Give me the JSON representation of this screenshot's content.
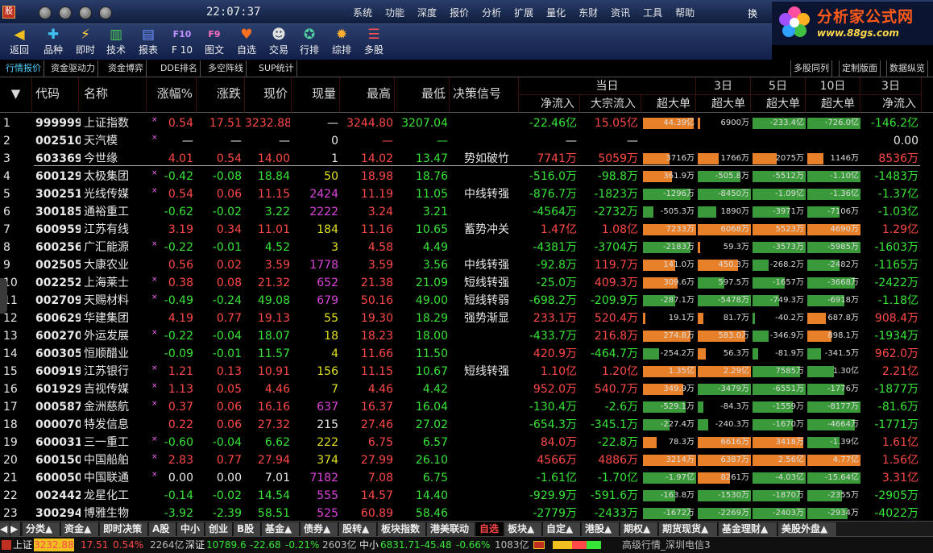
{
  "clock": "22:07:37",
  "menu": [
    "系统",
    "功能",
    "深度",
    "报价",
    "分析",
    "扩展",
    "量化",
    "东财",
    "资讯",
    "工具",
    "帮助"
  ],
  "menu_extra": "换",
  "logo": {
    "text": "分析家公式网",
    "url": "www.88gs.com"
  },
  "toolbar": [
    {
      "label": "返回",
      "icon": "arrow-left-icon",
      "glyph": "◀",
      "color": "#f0c020"
    },
    {
      "label": "品种",
      "icon": "category-icon",
      "glyph": "✚",
      "color": "#40c0f0"
    },
    {
      "label": "即时",
      "icon": "lightning-icon",
      "glyph": "⚡",
      "color": "#ffd040"
    },
    {
      "label": "技术",
      "icon": "candlestick-icon",
      "glyph": "▥",
      "color": "#50d050"
    },
    {
      "label": "报表",
      "icon": "table-icon",
      "glyph": "▤",
      "color": "#7090ff"
    },
    {
      "label": "F 10",
      "icon": "f10-icon",
      "glyph": "F10",
      "color": "#c090ff"
    },
    {
      "label": "图文",
      "icon": "f9-icon",
      "glyph": "F9",
      "color": "#ff70c0"
    },
    {
      "label": "自选",
      "icon": "heart-icon",
      "glyph": "♥",
      "color": "#ff7020"
    },
    {
      "label": "交易",
      "icon": "user-icon",
      "glyph": "☻",
      "color": "#e0e0e0"
    },
    {
      "label": "行排",
      "icon": "star-icon",
      "glyph": "✪",
      "color": "#50d0a0"
    },
    {
      "label": "综排",
      "icon": "starburst-icon",
      "glyph": "✹",
      "color": "#ffb030"
    },
    {
      "label": "多股",
      "icon": "multi-icon",
      "glyph": "☰",
      "color": "#ff5050"
    }
  ],
  "tabs_left": [
    "行情报价",
    "资金驱动力",
    "资金博弈",
    "DDE排名",
    "多空阵线",
    "SUP统计"
  ],
  "tabs_right": [
    "多股同列",
    "定制版面",
    "数据纵览"
  ],
  "columns": [
    "代码",
    "名称",
    "涨幅%",
    "涨跌",
    "现价",
    "现量",
    "最高",
    "最低",
    "决策信号"
  ],
  "groups": [
    "当日",
    "3日",
    "5日",
    "10日",
    "3日"
  ],
  "subcolumns": [
    "净流入",
    "大宗流入",
    "超大单",
    "超大单",
    "超大单",
    "超大单",
    "净流入"
  ],
  "rows": [
    {
      "n": "1",
      "code": "999999",
      "name": "上证指数",
      "m": "×",
      "pct": "0.54",
      "chg": "17.51",
      "price": "3232.88",
      "vol": "—",
      "high": "3244.80",
      "low": "3207.04",
      "signal": "",
      "net": "-22.46亿",
      "big": "15.05亿",
      "b": [
        {
          "v": "44.39亿",
          "w": 0.95,
          "p": 1
        },
        {
          "v": "6900万",
          "w": 0.05,
          "p": 1
        },
        {
          "v": "-233.4亿",
          "w": 1,
          "p": 0
        },
        {
          "v": "-726.0亿",
          "w": 1,
          "p": 0
        }
      ],
      "n3": "-146.2亿"
    },
    {
      "n": "2",
      "code": "002510",
      "name": "天汽模",
      "m": "×",
      "pct": "—",
      "chg": "—",
      "price": "—",
      "vol": "0",
      "high": "—",
      "low": "—",
      "signal": "",
      "net": "—",
      "big": "—",
      "b": [],
      "n3": "0.00"
    },
    {
      "n": "3",
      "code": "603369",
      "name": "今世缘",
      "m": "",
      "pct": "4.01",
      "chg": "0.54",
      "price": "14.00",
      "vol": "1",
      "high": "14.02",
      "low": "13.47",
      "signal": "势如破竹",
      "net": "7741万",
      "big": "5059万",
      "b": [
        {
          "v": "3716万",
          "w": 0.5,
          "p": 1
        },
        {
          "v": "1766万",
          "w": 0.4,
          "p": 1
        },
        {
          "v": "2075万",
          "w": 0.45,
          "p": 1
        },
        {
          "v": "1146万",
          "w": 0.3,
          "p": 1
        }
      ],
      "n3": "8536万"
    },
    {
      "n": "4",
      "code": "600129",
      "name": "太极集团",
      "m": "×",
      "pct": "-0.42",
      "chg": "-0.08",
      "price": "18.84",
      "vol": "50",
      "high": "18.98",
      "low": "18.76",
      "signal": "",
      "net": "-516.0万",
      "big": "-98.8万",
      "b": [
        {
          "v": "361.9万",
          "w": 0.55,
          "p": 1
        },
        {
          "v": "-505.8万",
          "w": 0.8,
          "p": 0
        },
        {
          "v": "-5512万",
          "w": 1,
          "p": 0
        },
        {
          "v": "-1.10亿",
          "w": 1,
          "p": 0
        }
      ],
      "n3": "-1483万"
    },
    {
      "n": "5",
      "code": "300251",
      "name": "光线传媒",
      "m": "×",
      "pct": "0.54",
      "chg": "0.06",
      "price": "11.15",
      "vol": "2424",
      "high": "11.19",
      "low": "11.05",
      "signal": "中线转强",
      "net": "-876.7万",
      "big": "-1823万",
      "b": [
        {
          "v": "-1296万",
          "w": 0.9,
          "p": 0
        },
        {
          "v": "-8450万",
          "w": 1,
          "p": 0
        },
        {
          "v": "-1.09亿",
          "w": 1,
          "p": 0
        },
        {
          "v": "-1.36亿",
          "w": 1,
          "p": 0
        }
      ],
      "n3": "-1.37亿"
    },
    {
      "n": "6",
      "code": "300185",
      "name": "通裕重工",
      "m": "",
      "pct": "-0.62",
      "chg": "-0.02",
      "price": "3.22",
      "vol": "2222",
      "high": "3.24",
      "low": "3.21",
      "signal": "",
      "net": "-4564万",
      "big": "-2732万",
      "b": [
        {
          "v": "-505.3万",
          "w": 0.2,
          "p": 0
        },
        {
          "v": "1890万",
          "w": 0.35,
          "p": 0
        },
        {
          "v": "-3971万",
          "w": 0.7,
          "p": 0
        },
        {
          "v": "-7106万",
          "w": 0.6,
          "p": 0
        }
      ],
      "n3": "-1.03亿"
    },
    {
      "n": "7",
      "code": "600959",
      "name": "江苏有线",
      "m": "",
      "pct": "3.19",
      "chg": "0.34",
      "price": "11.01",
      "vol": "184",
      "high": "11.16",
      "low": "10.65",
      "signal": "蓄势冲关",
      "net": "1.47亿",
      "big": "1.08亿",
      "b": [
        {
          "v": "7233万",
          "w": 1,
          "p": 1
        },
        {
          "v": "6068万",
          "w": 1,
          "p": 1
        },
        {
          "v": "5523万",
          "w": 1,
          "p": 1
        },
        {
          "v": "4690万",
          "w": 1,
          "p": 1
        }
      ],
      "n3": "1.29亿"
    },
    {
      "n": "8",
      "code": "600256",
      "name": "广汇能源",
      "m": "×",
      "pct": "-0.22",
      "chg": "-0.01",
      "price": "4.52",
      "vol": "3",
      "high": "4.58",
      "low": "4.49",
      "signal": "",
      "net": "-4381万",
      "big": "-3704万",
      "b": [
        {
          "v": "-2183万",
          "w": 0.9,
          "p": 0
        },
        {
          "v": "59.3万",
          "w": 0.05,
          "p": 1
        },
        {
          "v": "-3573万",
          "w": 1,
          "p": 0
        },
        {
          "v": "-5985万",
          "w": 1,
          "p": 0
        }
      ],
      "n3": "-1603万"
    },
    {
      "n": "9",
      "code": "002505",
      "name": "大康农业",
      "m": "",
      "pct": "0.56",
      "chg": "0.02",
      "price": "3.59",
      "vol": "1778",
      "high": "3.59",
      "low": "3.56",
      "signal": "中线转强",
      "net": "-92.8万",
      "big": "119.7万",
      "b": [
        {
          "v": "141.0万",
          "w": 0.6,
          "p": 1
        },
        {
          "v": "450.3万",
          "w": 0.75,
          "p": 1
        },
        {
          "v": "-268.2万",
          "w": 0.3,
          "p": 0
        },
        {
          "v": "-2482万",
          "w": 0.6,
          "p": 0
        }
      ],
      "n3": "-1165万"
    },
    {
      "n": "10",
      "code": "002252",
      "name": "上海莱士",
      "m": "×",
      "pct": "0.38",
      "chg": "0.08",
      "price": "21.32",
      "vol": "652",
      "high": "21.38",
      "low": "21.09",
      "signal": "短线转强",
      "net": "-25.0万",
      "big": "409.3万",
      "b": [
        {
          "v": "309.6万",
          "w": 0.65,
          "p": 1
        },
        {
          "v": "597.5万",
          "w": 0.5,
          "p": 0
        },
        {
          "v": "-1657万",
          "w": 0.6,
          "p": 0
        },
        {
          "v": "-3668万",
          "w": 0.9,
          "p": 0
        }
      ],
      "n3": "-2422万"
    },
    {
      "n": "11",
      "code": "002709",
      "name": "天赐材料",
      "m": "×",
      "pct": "-0.49",
      "chg": "-0.24",
      "price": "49.08",
      "vol": "679",
      "high": "50.16",
      "low": "49.00",
      "signal": "短线转弱",
      "net": "-698.2万",
      "big": "-209.9万",
      "b": [
        {
          "v": "-287.1万",
          "w": 0.6,
          "p": 0
        },
        {
          "v": "-5478万",
          "w": 1,
          "p": 0
        },
        {
          "v": "-749.3万",
          "w": 0.5,
          "p": 0
        },
        {
          "v": "-6918万",
          "w": 0.7,
          "p": 0
        }
      ],
      "n3": "-1.18亿"
    },
    {
      "n": "12",
      "code": "600629",
      "name": "华建集团",
      "m": "",
      "pct": "4.19",
      "chg": "0.77",
      "price": "19.13",
      "vol": "55",
      "high": "19.30",
      "low": "18.29",
      "signal": "强势渐显",
      "net": "233.1万",
      "big": "520.4万",
      "b": [
        {
          "v": "19.1万",
          "w": 0.05,
          "p": 1
        },
        {
          "v": "81.7万",
          "w": 0.1,
          "p": 1
        },
        {
          "v": "-40.2万",
          "w": 0.05,
          "p": 0
        },
        {
          "v": "687.8万",
          "w": 0.35,
          "p": 1
        }
      ],
      "n3": "908.4万"
    },
    {
      "n": "13",
      "code": "600270",
      "name": "外运发展",
      "m": "×",
      "pct": "-0.22",
      "chg": "-0.04",
      "price": "18.07",
      "vol": "18",
      "high": "18.23",
      "low": "18.00",
      "signal": "",
      "net": "-433.7万",
      "big": "216.8万",
      "b": [
        {
          "v": "274.8万",
          "w": 0.9,
          "p": 1
        },
        {
          "v": "583.0万",
          "w": 0.9,
          "p": 1
        },
        {
          "v": "-346.9万",
          "w": 0.3,
          "p": 0
        },
        {
          "v": "898.1万",
          "w": 0.45,
          "p": 1
        }
      ],
      "n3": "-1934万"
    },
    {
      "n": "14",
      "code": "600305",
      "name": "恒顺醋业",
      "m": "",
      "pct": "-0.09",
      "chg": "-0.01",
      "price": "11.57",
      "vol": "4",
      "high": "11.66",
      "low": "11.50",
      "signal": "",
      "net": "420.9万",
      "big": "-464.7万",
      "b": [
        {
          "v": "-254.2万",
          "w": 0.3,
          "p": 0
        },
        {
          "v": "56.3万",
          "w": 0.15,
          "p": 1
        },
        {
          "v": "-81.9万",
          "w": 0.1,
          "p": 0
        },
        {
          "v": "-341.5万",
          "w": 0.25,
          "p": 0
        }
      ],
      "n3": "962.0万"
    },
    {
      "n": "15",
      "code": "600919",
      "name": "江苏银行",
      "m": "×",
      "pct": "1.21",
      "chg": "0.13",
      "price": "10.91",
      "vol": "156",
      "high": "11.15",
      "low": "10.67",
      "signal": "短线转强",
      "net": "1.10亿",
      "big": "1.20亿",
      "b": [
        {
          "v": "1.35亿",
          "w": 1,
          "p": 1
        },
        {
          "v": "2.29亿",
          "w": 1,
          "p": 1
        },
        {
          "v": "7585万",
          "w": 0.9,
          "p": 0
        },
        {
          "v": "1.30亿",
          "w": 0.5,
          "p": 0
        }
      ],
      "n3": "2.21亿"
    },
    {
      "n": "16",
      "code": "601929",
      "name": "吉视传媒",
      "m": "×",
      "pct": "1.13",
      "chg": "0.05",
      "price": "4.46",
      "vol": "7",
      "high": "4.46",
      "low": "4.42",
      "signal": "",
      "net": "952.0万",
      "big": "540.7万",
      "b": [
        {
          "v": "349.9万",
          "w": 0.75,
          "p": 1
        },
        {
          "v": "-3479万",
          "w": 1,
          "p": 0
        },
        {
          "v": "-6551万",
          "w": 1,
          "p": 0
        },
        {
          "v": "-1776万",
          "w": 0.7,
          "p": 0
        }
      ],
      "n3": "-1877万"
    },
    {
      "n": "17",
      "code": "000587",
      "name": "金洲慈航",
      "m": "×",
      "pct": "0.37",
      "chg": "0.06",
      "price": "16.16",
      "vol": "637",
      "high": "16.37",
      "low": "16.04",
      "signal": "",
      "net": "-130.4万",
      "big": "-2.6万",
      "b": [
        {
          "v": "-529.1万",
          "w": 0.8,
          "p": 0
        },
        {
          "v": "-84.3万",
          "w": 0.1,
          "p": 0
        },
        {
          "v": "-1559万",
          "w": 0.75,
          "p": 0
        },
        {
          "v": "-8177万",
          "w": 1,
          "p": 0
        }
      ],
      "n3": "-81.6万"
    },
    {
      "n": "18",
      "code": "000070",
      "name": "特发信息",
      "m": "",
      "pct": "0.22",
      "chg": "0.06",
      "price": "27.32",
      "vol": "215",
      "high": "27.46",
      "low": "27.02",
      "signal": "",
      "net": "-654.3万",
      "big": "-345.1万",
      "b": [
        {
          "v": "-227.4万",
          "w": 0.5,
          "p": 0
        },
        {
          "v": "-240.3万",
          "w": 0.2,
          "p": 0
        },
        {
          "v": "-1670万",
          "w": 0.75,
          "p": 0
        },
        {
          "v": "-4664万",
          "w": 0.9,
          "p": 0
        }
      ],
      "n3": "-1771万"
    },
    {
      "n": "19",
      "code": "600031",
      "name": "三一重工",
      "m": "×",
      "pct": "-0.60",
      "chg": "-0.04",
      "price": "6.62",
      "vol": "222",
      "high": "6.75",
      "low": "6.57",
      "signal": "",
      "net": "84.0万",
      "big": "-22.8万",
      "b": [
        {
          "v": "78.3万",
          "w": 0.25,
          "p": 1
        },
        {
          "v": "6616万",
          "w": 1,
          "p": 1
        },
        {
          "v": "3418万",
          "w": 0.95,
          "p": 1
        },
        {
          "v": "-1.39亿",
          "w": 0.6,
          "p": 0
        }
      ],
      "n3": "1.61亿"
    },
    {
      "n": "20",
      "code": "600150",
      "name": "中国船舶",
      "m": "×",
      "pct": "2.83",
      "chg": "0.77",
      "price": "27.94",
      "vol": "374",
      "high": "27.99",
      "low": "26.10",
      "signal": "",
      "net": "4566万",
      "big": "4886万",
      "b": [
        {
          "v": "3214万",
          "w": 1,
          "p": 1
        },
        {
          "v": "6387万",
          "w": 1,
          "p": 1
        },
        {
          "v": "2.56亿",
          "w": 1,
          "p": 1
        },
        {
          "v": "4.77亿",
          "w": 1,
          "p": 1
        }
      ],
      "n3": "1.56亿"
    },
    {
      "n": "21",
      "code": "600050",
      "name": "中国联通",
      "m": "×",
      "pct": "0.00",
      "chg": "0.00",
      "price": "7.01",
      "vol": "7182",
      "high": "7.08",
      "low": "6.75",
      "signal": "",
      "net": "-1.61亿",
      "big": "-1.70亿",
      "b": [
        {
          "v": "-1.97亿",
          "w": 1,
          "p": 0
        },
        {
          "v": "8261万",
          "w": 0.6,
          "p": 1
        },
        {
          "v": "-4.03亿",
          "w": 1,
          "p": 0
        },
        {
          "v": "-15.64亿",
          "w": 1,
          "p": 0
        }
      ],
      "n3": "3.31亿"
    },
    {
      "n": "22",
      "code": "002442",
      "name": "龙星化工",
      "m": "",
      "pct": "-0.14",
      "chg": "-0.02",
      "price": "14.54",
      "vol": "555",
      "high": "14.57",
      "low": "14.40",
      "signal": "",
      "net": "-929.9万",
      "big": "-591.6万",
      "b": [
        {
          "v": "-163.8万",
          "w": 0.6,
          "p": 0
        },
        {
          "v": "-1530万",
          "w": 1,
          "p": 0
        },
        {
          "v": "-1870万",
          "w": 0.9,
          "p": 0
        },
        {
          "v": "-2355万",
          "w": 0.65,
          "p": 0
        }
      ],
      "n3": "-2905万"
    },
    {
      "n": "23",
      "code": "300294",
      "name": "博雅生物",
      "m": "",
      "pct": "-3.92",
      "chg": "-2.39",
      "price": "58.51",
      "vol": "525",
      "high": "60.89",
      "low": "58.46",
      "signal": "",
      "net": "-2779万",
      "big": "-2433万",
      "b": [
        {
          "v": "-1672万",
          "w": 0.9,
          "p": 0
        },
        {
          "v": "-2269万",
          "w": 1,
          "p": 0
        },
        {
          "v": "-2403万",
          "w": 1,
          "p": 0
        },
        {
          "v": "-2934万",
          "w": 0.75,
          "p": 0
        }
      ],
      "n3": "-4022万"
    }
  ],
  "bottom_tabs": [
    "分类▲",
    "资金▲",
    "即时决策",
    "A股",
    "中小",
    "创业",
    "B股",
    "基金▲",
    "债券▲",
    "股转▲",
    "板块指数",
    "港美联动",
    "自选",
    "板块▲",
    "自定▲",
    "港股▲",
    "期权▲",
    "期货现货▲",
    "基金理财▲",
    "美股外盘▲"
  ],
  "bottom_selected": "自选",
  "status": {
    "sh_label": "上证",
    "sh_val": "3232.88",
    "sh_chg": "17.51",
    "sh_pct": "0.54%",
    "sh_amt": "2264亿",
    "sz_label": "深证",
    "sz_val": "10789.6",
    "sz_chg": "-22.68",
    "sz_pct": "-0.21%",
    "sz_amt": "2603亿",
    "zx_label": "中小",
    "zx_val": "6831.71",
    "zx_chg": "-45.48",
    "zx_pct": "-0.66%",
    "zx_amt": "1083亿",
    "conn": "高级行情_深圳电信3"
  },
  "colors": {
    "up": "#ff4848",
    "down": "#37e437",
    "bar_up": "#e8802a",
    "bar_down": "#3a9a3a"
  }
}
